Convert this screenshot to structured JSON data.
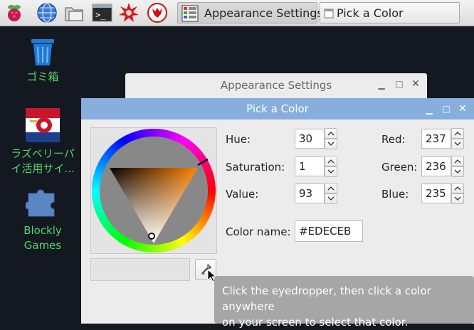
{
  "taskbar": {
    "launchers": [
      "raspberry-menu-icon",
      "web-browser-icon",
      "file-manager-icon",
      "terminal-icon",
      "math-star-icon",
      "wolfram-icon"
    ],
    "tasks": [
      {
        "label": "Appearance Settings",
        "icon": "appearance-settings-icon"
      },
      {
        "label": "Pick a Color",
        "icon": "window-icon"
      }
    ]
  },
  "desktop": {
    "icons": [
      {
        "label": "ゴミ箱",
        "icon": "trash-icon"
      },
      {
        "label_line1": "ラズベリーパ",
        "label_line2": "イ活用サイ...",
        "icon": "raspberry-pi-site-icon"
      },
      {
        "label_line1": "Blockly",
        "label_line2": "Games",
        "icon": "puzzle-icon"
      }
    ]
  },
  "bg_window": {
    "title": "Appearance Settings"
  },
  "dialog": {
    "title": "Pick a Color",
    "hue_label": "Hue:",
    "hue": "30",
    "saturation_label": "Saturation:",
    "saturation": "1",
    "value_label": "Value:",
    "value": "93",
    "red_label": "Red:",
    "red": "237",
    "green_label": "Green:",
    "green": "236",
    "blue_label": "Blue:",
    "blue": "235",
    "color_name_label": "Color name:",
    "color_name": "#EDECEB"
  },
  "tooltip": {
    "line1": "Click the eyedropper, then click a color anywhere",
    "line2": "on your screen to select that color."
  },
  "colors": {
    "titlebar_active": "#87aedd",
    "desktop_label": "#4fd76a",
    "selected_color": "#EDECEB"
  }
}
